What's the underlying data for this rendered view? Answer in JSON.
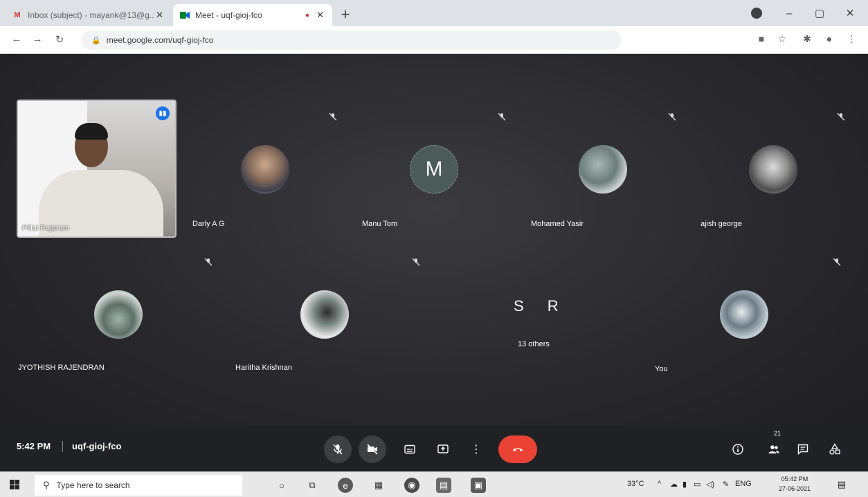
{
  "browser": {
    "tabs": [
      {
        "title": "Inbox (subject) - mayank@13@g...",
        "favicon": "gmail-icon",
        "state": "inactive"
      },
      {
        "title": "Meet - uqf-gioj-fco",
        "favicon": "meet-icon",
        "state": "active"
      }
    ],
    "url": "meet.google.com/uqf-gioj-fco",
    "new_tab": "+",
    "minimize": "–",
    "maximize": "▢",
    "close": "✕"
  },
  "meeting": {
    "self_name": "Pillai Rajaram",
    "participants": [
      {
        "name": "Darly A G",
        "initial": ""
      },
      {
        "name": "Manu Tom",
        "initial": "M"
      },
      {
        "name": "Mohamed Yasir",
        "initial": ""
      },
      {
        "name": "ajish george",
        "initial": ""
      },
      {
        "name": "JYOTHISH RAJENDRAN",
        "initial": ""
      },
      {
        "name": "Haritha Krishnan",
        "initial": ""
      },
      {
        "name": "You",
        "initial": ""
      }
    ],
    "others": {
      "letters": [
        "S",
        "R"
      ],
      "label": "13 others"
    }
  },
  "controls": {
    "time": "5:42 PM",
    "code": "uqf-gioj-fco",
    "people_count": "21",
    "more": "⋮"
  },
  "taskbar": {
    "search_placeholder": "Type here to search",
    "temperature": "33°C",
    "language": "ENG",
    "clock_time": "05:42 PM",
    "clock_date": "27-06-2021"
  }
}
